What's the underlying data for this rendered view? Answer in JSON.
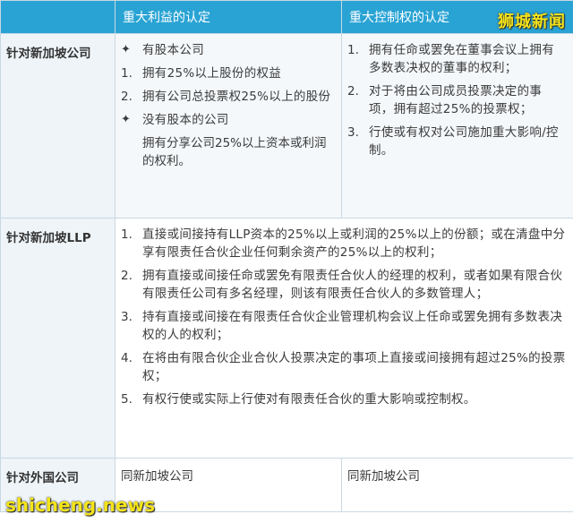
{
  "header": {
    "col1": "",
    "col2": "重大利益的认定",
    "col3": "重大控制权的认定"
  },
  "rows": {
    "sg_company": {
      "label": "针对新加坡公司",
      "interest": {
        "section1_title": "有股本公司",
        "items": [
          {
            "num": "1.",
            "text": "拥有25%以上股份的权益"
          },
          {
            "num": "2.",
            "text": "拥有公司总投票权25%以上的股份"
          }
        ],
        "section2_title": "没有股本的公司",
        "section2_text": "拥有分享公司25%以上资本或利润的权利。"
      },
      "control": [
        {
          "num": "1.",
          "text": "拥有任命或罢免在董事会议上拥有多数表决权的董事的权利；"
        },
        {
          "num": "2.",
          "text": "对于将由公司成员投票决定的事项，拥有超过25%的投票权；"
        },
        {
          "num": "3.",
          "text": "行使或有权对公司施加重大影响/控制。"
        }
      ]
    },
    "sg_llp": {
      "label": "针对新加坡LLP",
      "items": [
        {
          "num": "1.",
          "text": "直接或间接持有LLP资本的25%以上或利润的25%以上的份额；或在清盘中分享有限责任合伙企业任何剩余资产的25%以上的权利；"
        },
        {
          "num": "2.",
          "text": "拥有直接或间接任命或罢免有限责任合伙人的经理的权利，或者如果有限合伙有限责任公司有多名经理，则该有限责任合伙人的多数管理人；"
        },
        {
          "num": "3.",
          "text": "持有直接或间接在有限责任合伙企业管理机构会议上任命或罢免拥有多数表决权的人的权利；"
        },
        {
          "num": "4.",
          "text": "在将由有限合伙企业合伙人投票决定的事项上直接或间接拥有超过25%的投票权；"
        },
        {
          "num": "5.",
          "text": "有权行使或实际上行使对有限责任合伙的重大影响或控制权。"
        }
      ]
    },
    "foreign": {
      "label": "针对外国公司",
      "interest": "同新加坡公司",
      "control": "同新加坡公司"
    }
  },
  "watermarks": {
    "top": "狮城新闻",
    "bottom": "shicheng.news"
  }
}
